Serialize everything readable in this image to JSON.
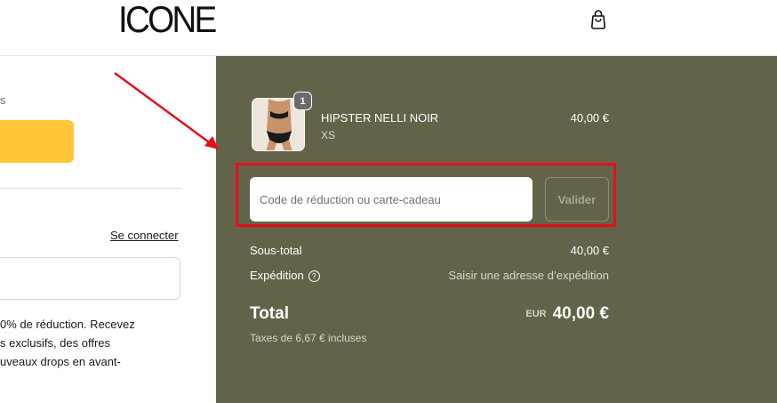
{
  "header": {
    "logo_text": "ICONE",
    "cart_icon": "shopping-bag-icon"
  },
  "left": {
    "fragment_s": "s",
    "login_link": "Se connecter",
    "promo_lines": [
      "0% de réduction. Recevez",
      "s exclusifs, des offres",
      "uveaux drops en avant-"
    ]
  },
  "order": {
    "item": {
      "quantity": "1",
      "name": "HIPSTER NELLI NOIR",
      "variant": "XS",
      "price": "40,00 €"
    },
    "discount": {
      "placeholder": "Code de réduction ou carte-cadeau",
      "button_label": "Valider"
    },
    "subtotal_label": "Sous-total",
    "subtotal_value": "40,00 €",
    "shipping_label": "Expédition",
    "shipping_value": "Saisir une adresse d’expédition",
    "total_label": "Total",
    "total_currency": "EUR",
    "total_value": "40,00 €",
    "tax_note": "Taxes de 6,67 € incluses"
  },
  "colors": {
    "summary_bg": "#63634a",
    "express_pay": "#ffc738",
    "highlight_box": "#e3111a",
    "annotation_arrow": "#e3111a"
  }
}
